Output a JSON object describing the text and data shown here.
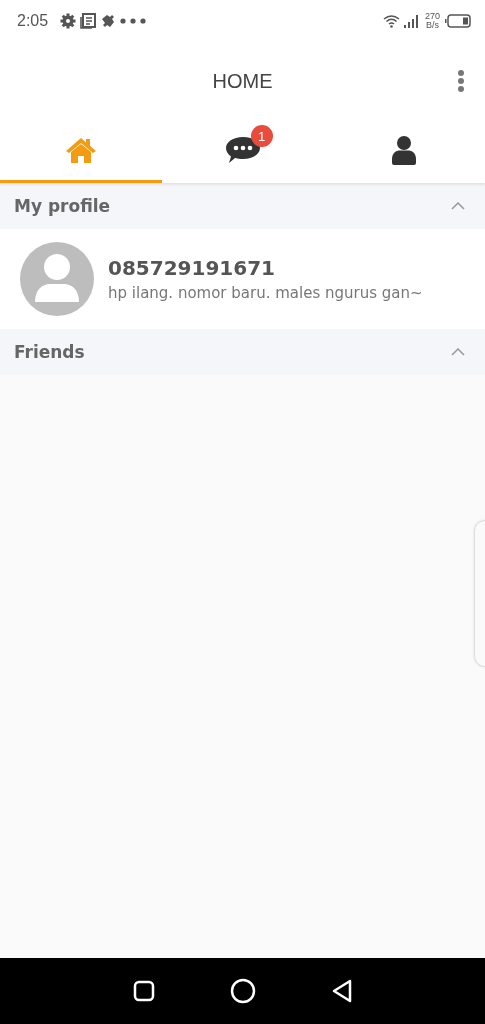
{
  "status_bar": {
    "time": "2:05",
    "speed_value": "270",
    "speed_unit": "B/s"
  },
  "app_bar": {
    "title": "HOME"
  },
  "tabs": [
    {
      "kind": "home",
      "selected": true
    },
    {
      "kind": "chat",
      "selected": false,
      "badge": "1"
    },
    {
      "kind": "person",
      "selected": false
    }
  ],
  "sections": [
    {
      "title": "My profile",
      "expanded": true,
      "items": [
        {
          "name": "085729191671",
          "status": "hp ilang. nomor baru. males ngurus gan~"
        }
      ]
    },
    {
      "title": "Friends",
      "expanded": true
    }
  ]
}
